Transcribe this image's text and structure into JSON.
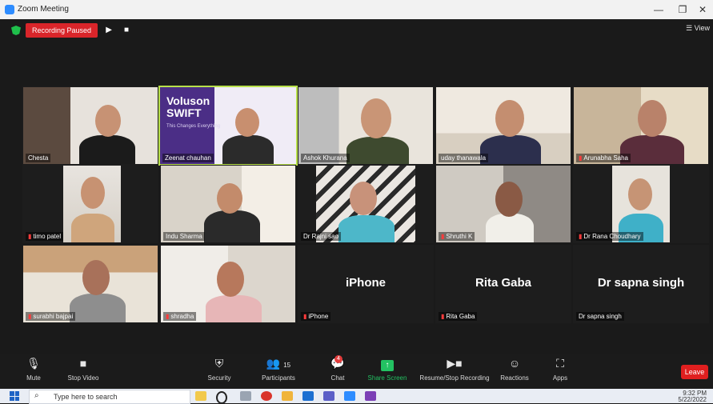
{
  "window": {
    "title": "Zoom Meeting",
    "minimize": "—",
    "restore": "❐",
    "close": "✕"
  },
  "recording": {
    "label": "Recording Paused",
    "resume_icon": "▶",
    "stop_icon": "■"
  },
  "view_label": "☰ View",
  "tiles": [
    {
      "name": "Chesta"
    },
    {
      "name": "Zeenat chauhan",
      "banner_title": "Voluson SWIFT",
      "banner_sub": "This Changes Everything"
    },
    {
      "name": "Ashok Khurana"
    },
    {
      "name": "uday thanawala"
    },
    {
      "name": "Arunabha Saha"
    },
    {
      "name": "timo patel"
    },
    {
      "name": "Indu Sharma"
    },
    {
      "name": "Dr Rajni sao"
    },
    {
      "name": "Shruthi K"
    },
    {
      "name": "Dr Rana Choudhary"
    },
    {
      "name": "surabhi bajpai"
    },
    {
      "name": "shradha"
    },
    {
      "name": "iPhone",
      "display": "iPhone"
    },
    {
      "name": "Rita Gaba",
      "display": "Rita Gaba"
    },
    {
      "name": "Dr sapna singh",
      "display": "Dr sapna singh"
    }
  ],
  "toolbar": {
    "mute": "Mute",
    "stop_video": "Stop Video",
    "security": "Security",
    "participants": "Participants",
    "participants_count": "15",
    "chat": "Chat",
    "chat_badge": "4",
    "share_screen": "Share Screen",
    "resume_stop_recording": "Resume/Stop Recording",
    "reactions": "Reactions",
    "apps": "Apps",
    "leave": "Leave"
  },
  "taskbar": {
    "search_placeholder": "Type here to search",
    "time": "9:32 PM",
    "date": "5/22/2022"
  }
}
